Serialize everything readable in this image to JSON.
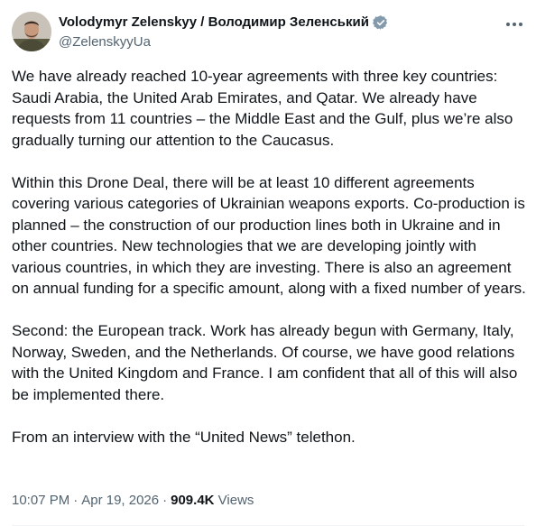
{
  "author": {
    "display_name": "Volodymyr Zelenskyy / Володимир Зеленський",
    "handle": "@ZelenskyyUa",
    "avatar_icon": "avatar-photo",
    "verified_icon": "verified-badge-icon",
    "verified_color": "#829aab"
  },
  "more_icon": "more-options-icon",
  "tweet": {
    "paragraphs": [
      "We have already reached 10-year agreements with three key countries: Saudi Arabia, the United Arab Emirates, and Qatar. We already have requests from 11 countries – the Middle East and the Gulf, plus we’re also gradually turning our attention to the Caucasus.",
      "Within this Drone Deal, there will be at least 10 different agreements covering various categories of Ukrainian weapons exports. Co-production is planned – the construction of our production lines both in Ukraine and in other countries. New technologies that we are developing jointly with various countries, in which they are investing. There is also an agreement on annual funding for a specific amount, along with a fixed number of years.",
      "Second: the European track. Work has already begun with Germany, Italy, Norway, Sweden, and the Netherlands. Of course, we have good relations with the United Kingdom and France. I am confident that all of this will also be implemented there.",
      "From an interview with the “United News” telethon."
    ]
  },
  "meta": {
    "time": "10:07 PM",
    "date": "Apr 19, 2026",
    "separator": "·",
    "views_count": "909.4K",
    "views_label": "Views"
  },
  "colors": {
    "text": "#0f1419",
    "secondary": "#536471",
    "background": "#ffffff"
  }
}
